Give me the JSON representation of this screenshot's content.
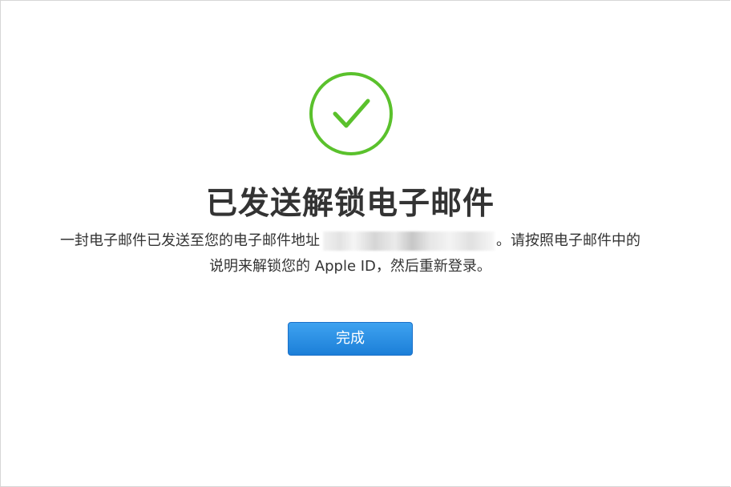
{
  "title": "已发送解锁电子邮件",
  "message": {
    "line1_prefix": "一封电子邮件已发送至您的电子邮件地址",
    "line1_suffix": "。请按照电子邮件中的",
    "line2": "说明来解锁您的 Apple ID，然后重新登录。"
  },
  "icons": {
    "status": "checkmark-circle-icon"
  },
  "button": {
    "done_label": "完成"
  },
  "colors": {
    "success": "#5ac12c",
    "button": "#1c7fd8",
    "text": "#333333"
  }
}
